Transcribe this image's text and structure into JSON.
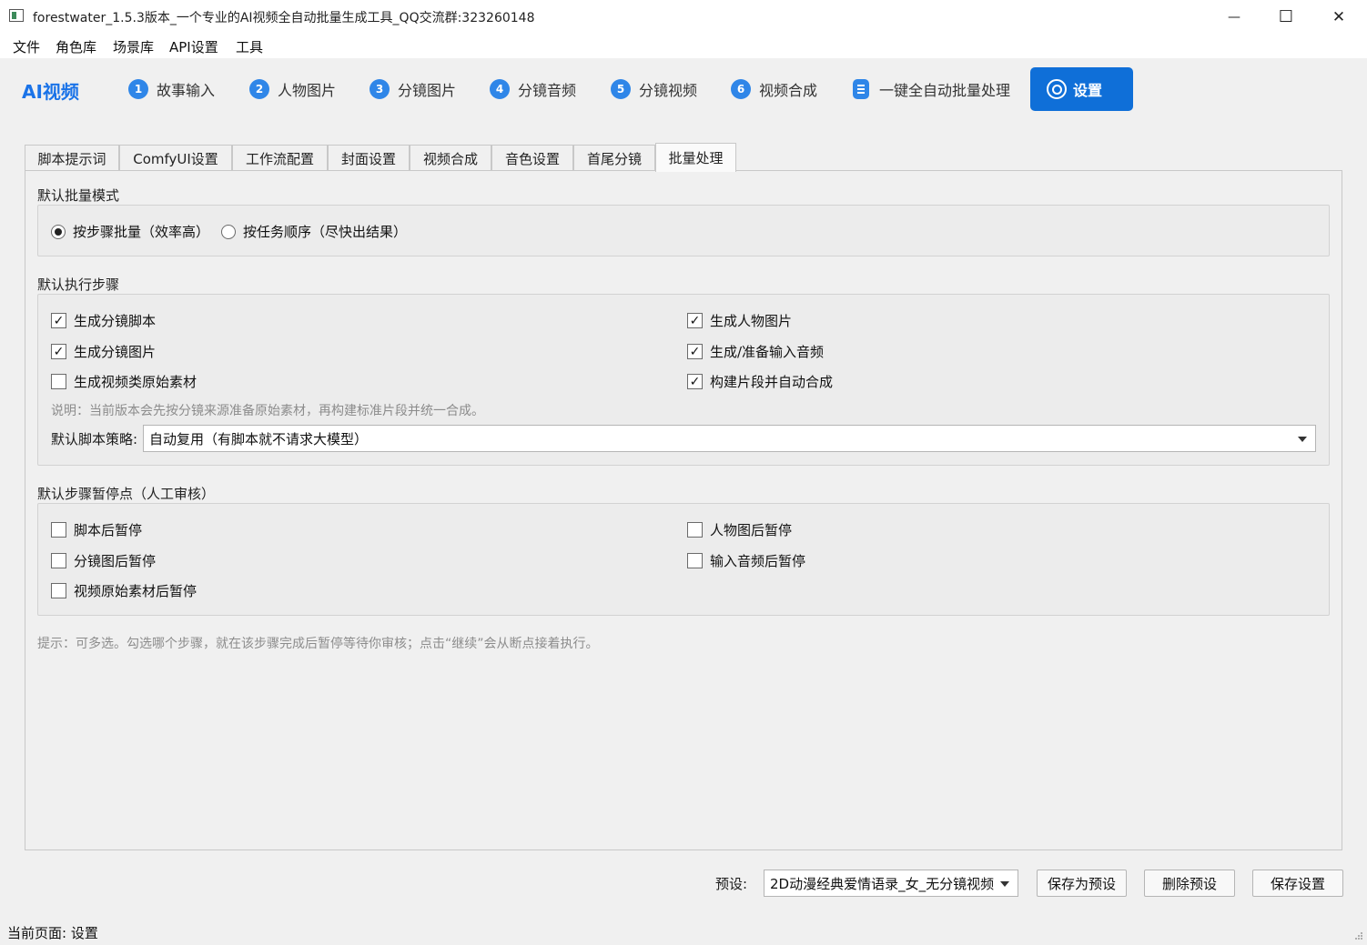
{
  "window": {
    "title": "forestwater_1.5.3版本_一个专业的AI视频全自动批量生成工具_QQ交流群:323260148",
    "minimize": "—",
    "maximize": "☐",
    "close": "✕"
  },
  "menu": [
    "文件",
    "角色库",
    "场景库",
    "API设置",
    "工具"
  ],
  "nav": {
    "brand": "AI视频",
    "items": [
      {
        "num": "1",
        "label": "故事输入"
      },
      {
        "num": "2",
        "label": "人物图片"
      },
      {
        "num": "3",
        "label": "分镜图片"
      },
      {
        "num": "4",
        "label": "分镜音频"
      },
      {
        "num": "5",
        "label": "分镜视频"
      },
      {
        "num": "6",
        "label": "视频合成"
      }
    ],
    "batch": "一键全自动批量处理",
    "settings": "设置",
    "accent": "#0f6fd8"
  },
  "tabs": [
    "脚本提示词",
    "ComfyUI设置",
    "工作流配置",
    "封面设置",
    "视频合成",
    "音色设置",
    "首尾分镜",
    "批量处理"
  ],
  "active_tab": "批量处理",
  "batch_mode": {
    "title": "默认批量模式",
    "options": [
      {
        "label": "按步骤批量（效率高）",
        "checked": true
      },
      {
        "label": "按任务顺序（尽快出结果）",
        "checked": false
      }
    ]
  },
  "steps": {
    "title": "默认执行步骤",
    "items": [
      {
        "label": "生成分镜脚本",
        "checked": true,
        "mark": "✓"
      },
      {
        "label": "生成人物图片",
        "checked": true,
        "mark": "✓"
      },
      {
        "label": "生成分镜图片",
        "checked": true,
        "mark": "✓"
      },
      {
        "label": "生成/准备输入音频",
        "checked": true,
        "mark": "✓"
      },
      {
        "label": "生成视频类原始素材",
        "checked": false,
        "mark": ""
      },
      {
        "label": "构建片段并自动合成",
        "checked": true,
        "mark": "✓"
      }
    ],
    "note": "说明：当前版本会先按分镜来源准备原始素材，再构建标准片段并统一合成。",
    "strategy_label": "默认脚本策略:",
    "strategy_value": "自动复用（有脚本就不请求大模型）"
  },
  "pauses": {
    "title": "默认步骤暂停点（人工审核）",
    "items": [
      {
        "label": "脚本后暂停",
        "checked": false
      },
      {
        "label": "人物图后暂停",
        "checked": false
      },
      {
        "label": "分镜图后暂停",
        "checked": false
      },
      {
        "label": "输入音频后暂停",
        "checked": false
      },
      {
        "label": "视频原始素材后暂停",
        "checked": false
      }
    ],
    "hint": "提示：可多选。勾选哪个步骤，就在该步骤完成后暂停等待你审核；点击“继续”会从断点接着执行。"
  },
  "footer": {
    "preset_label": "预设:",
    "preset_value": "2D动漫经典爱情语录_女_无分镜视频",
    "save_as_preset": "保存为预设",
    "delete_preset": "删除预设",
    "save_settings": "保存设置"
  },
  "status": "当前页面: 设置"
}
